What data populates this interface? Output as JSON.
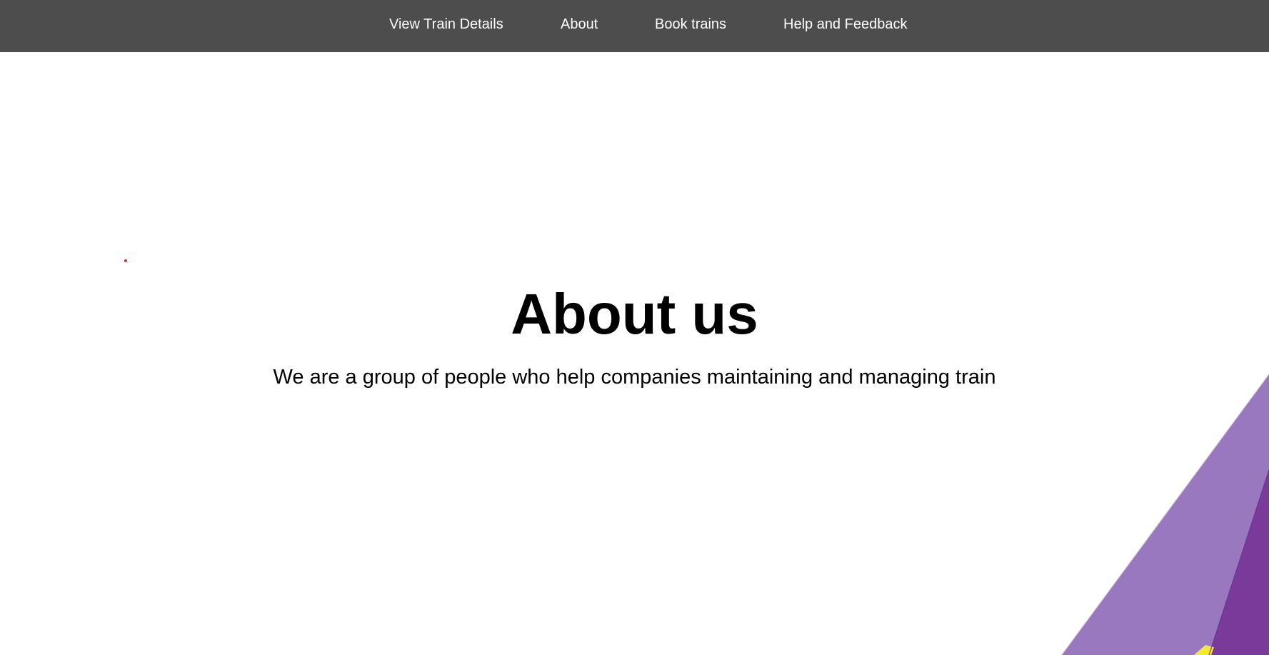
{
  "nav": {
    "items": [
      {
        "label": "View Train Details"
      },
      {
        "label": "About"
      },
      {
        "label": "Book trains"
      },
      {
        "label": "Help and Feedback"
      }
    ]
  },
  "hero": {
    "title": "About us",
    "subtitle": "We are a group of people who help companies maintaining and managing train"
  },
  "colors": {
    "navbar_bg": "#4d4d4d",
    "nav_text": "#ffffff",
    "page_bg": "#ffffff",
    "decor_purple_light": "#9a78c0",
    "decor_purple_dark": "#7a3a9a",
    "decor_yellow": "#f2ea2e",
    "cursor_dot": "#e52b2b"
  }
}
